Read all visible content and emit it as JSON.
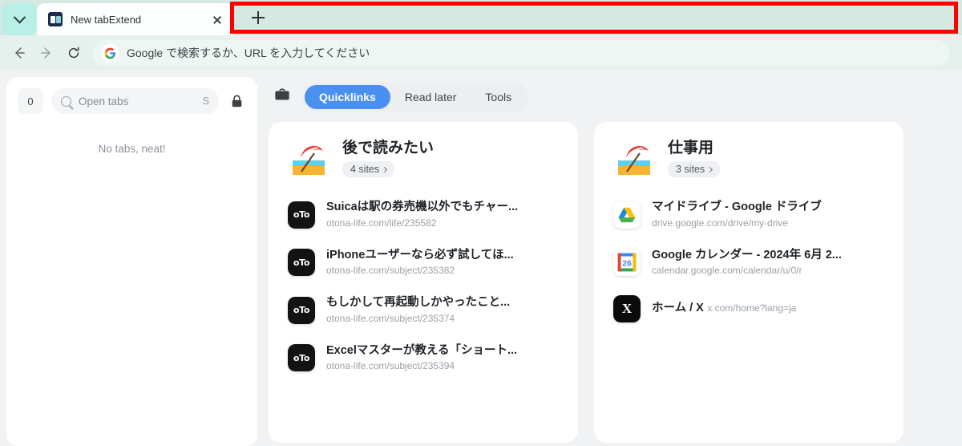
{
  "browser": {
    "tab": {
      "title": "New tabExtend",
      "favicon": "book-favicon",
      "close_label": "×"
    },
    "tab_search_icon": "chevron-down-icon",
    "new_tab_icon": "plus-icon",
    "annotation": {
      "color": "#ff0000",
      "shape": "rectangle"
    },
    "toolbar": {
      "back_icon": "back-arrow-icon",
      "forward_icon": "forward-arrow-icon",
      "reload_icon": "reload-icon",
      "omnibox_icon": "google-g-icon",
      "omnibox_placeholder": "Google で検索するか、URL を入力してください"
    }
  },
  "sidebar": {
    "tab_count": "0",
    "search": {
      "icon": "search-icon",
      "placeholder": "Open tabs",
      "shortcut": "S"
    },
    "lock_icon": "lock-icon",
    "empty_message": "No tabs, neat!"
  },
  "main": {
    "workspace_icon": "briefcase-icon",
    "tabs": [
      {
        "label": "Quicklinks",
        "active": true
      },
      {
        "label": "Read later",
        "active": false
      },
      {
        "label": "Tools",
        "active": false
      }
    ],
    "cards": [
      {
        "emoji": "beach-umbrella-icon",
        "title": "後で読みたい",
        "count_label": "4 sites",
        "items": [
          {
            "favicon": "otona-life-favicon",
            "favicon_text": "oTo",
            "title": "Suicaは駅の券売機以外でもチャー...",
            "url": "otona-life.com/life/235582"
          },
          {
            "favicon": "otona-life-favicon",
            "favicon_text": "oTo",
            "title": "iPhoneユーザーなら必ず試してほ...",
            "url": "otona-life.com/subject/235382"
          },
          {
            "favicon": "otona-life-favicon",
            "favicon_text": "oTo",
            "title": "もしかして再起動しかやったこと...",
            "url": "otona-life.com/subject/235374"
          },
          {
            "favicon": "otona-life-favicon",
            "favicon_text": "oTo",
            "title": "Excelマスターが教える「ショート...",
            "url": "otona-life.com/subject/235394"
          }
        ]
      },
      {
        "emoji": "beach-umbrella-icon",
        "title": "仕事用",
        "count_label": "3 sites",
        "items": [
          {
            "favicon": "google-drive-favicon",
            "favicon_text": "",
            "title": "マイドライブ - Google ドライブ",
            "url": "drive.google.com/drive/my-drive"
          },
          {
            "favicon": "google-calendar-favicon",
            "favicon_text": "26",
            "title": "Google カレンダー - 2024年 6月 2...",
            "url": "calendar.google.com/calendar/u/0/r"
          },
          {
            "favicon": "x-favicon",
            "favicon_text": "X",
            "title": "ホーム / X",
            "url": "x.com/home?lang=ja"
          }
        ]
      }
    ]
  },
  "colors": {
    "chrome_bg": "#d6e8e2",
    "accent_blue": "#4a90f0",
    "page_bg": "#f1f2f4",
    "annotation_red": "#ff0000"
  }
}
